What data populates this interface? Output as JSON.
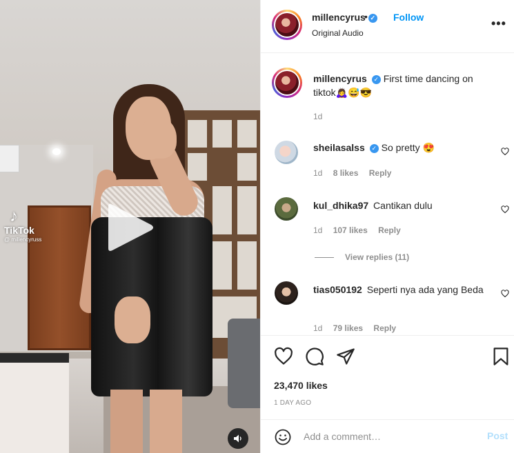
{
  "video": {
    "watermark_brand": "TikTok",
    "watermark_user": "@ millencyruss",
    "play_icon": "play-icon",
    "sound_icon": "speaker-icon"
  },
  "header": {
    "username": "millencyrus",
    "separator": "•",
    "follow_label": "Follow",
    "audio": "Original Audio",
    "more_label": "•••"
  },
  "caption": {
    "username": "millencyrus",
    "text": "First time dancing on tiktok🙇‍♀️😅😎",
    "time": "1d"
  },
  "comments": [
    {
      "username": "sheilasalss",
      "verified": true,
      "text": "So pretty 😍",
      "time": "1d",
      "likes": "8 likes",
      "reply": "Reply"
    },
    {
      "username": "kul_dhika97",
      "verified": false,
      "text": "Cantikan dulu",
      "time": "1d",
      "likes": "107 likes",
      "reply": "Reply"
    },
    {
      "username": "tias050192",
      "verified": false,
      "text": "Seperti nya ada yang Beda",
      "time": "1d",
      "likes": "79 likes",
      "reply": "Reply"
    }
  ],
  "view_replies": "View replies (11)",
  "actions": {
    "likes": "23,470 likes",
    "date": "1 DAY AGO"
  },
  "add_comment": {
    "placeholder": "Add a comment…",
    "post_label": "Post"
  },
  "colors": {
    "accent": "#0095f6",
    "post_disabled": "#b2dffc",
    "verified": "#3897f0",
    "muted_text": "#8e8e8e"
  }
}
